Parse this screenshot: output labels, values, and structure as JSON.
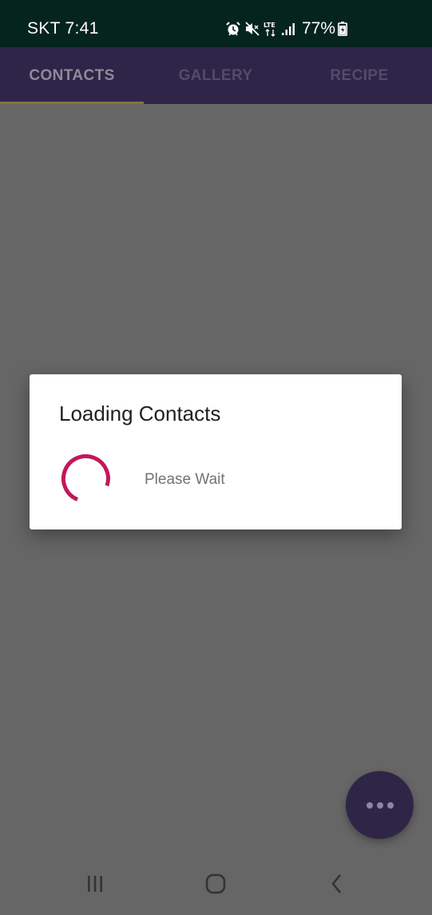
{
  "status_bar": {
    "carrier_time": "SKT 7:41",
    "battery_percent": "77%",
    "icons": [
      "alarm-icon",
      "mute-icon",
      "lte-icon",
      "signal-icon",
      "battery-charging-icon"
    ]
  },
  "tabs": [
    {
      "label": "CONTACTS",
      "selected": true
    },
    {
      "label": "GALLERY",
      "selected": false
    },
    {
      "label": "RECIPE",
      "selected": false
    }
  ],
  "dialog": {
    "title": "Loading Contacts",
    "message": "Please Wait",
    "spinner_icon": "progress-spinner-icon"
  },
  "fab": {
    "icon": "more-horizontal-icon"
  },
  "nav_bar": {
    "icons": [
      "recents-icon",
      "home-icon",
      "back-icon"
    ]
  },
  "colors": {
    "status_bar_bg": "#06241e",
    "tab_bar_bg": "#2e2548",
    "scrim_bg": "#666666",
    "spinner": "#c2185b",
    "fab_bg": "#2f2647",
    "tab_indicator": "#8a7134"
  }
}
